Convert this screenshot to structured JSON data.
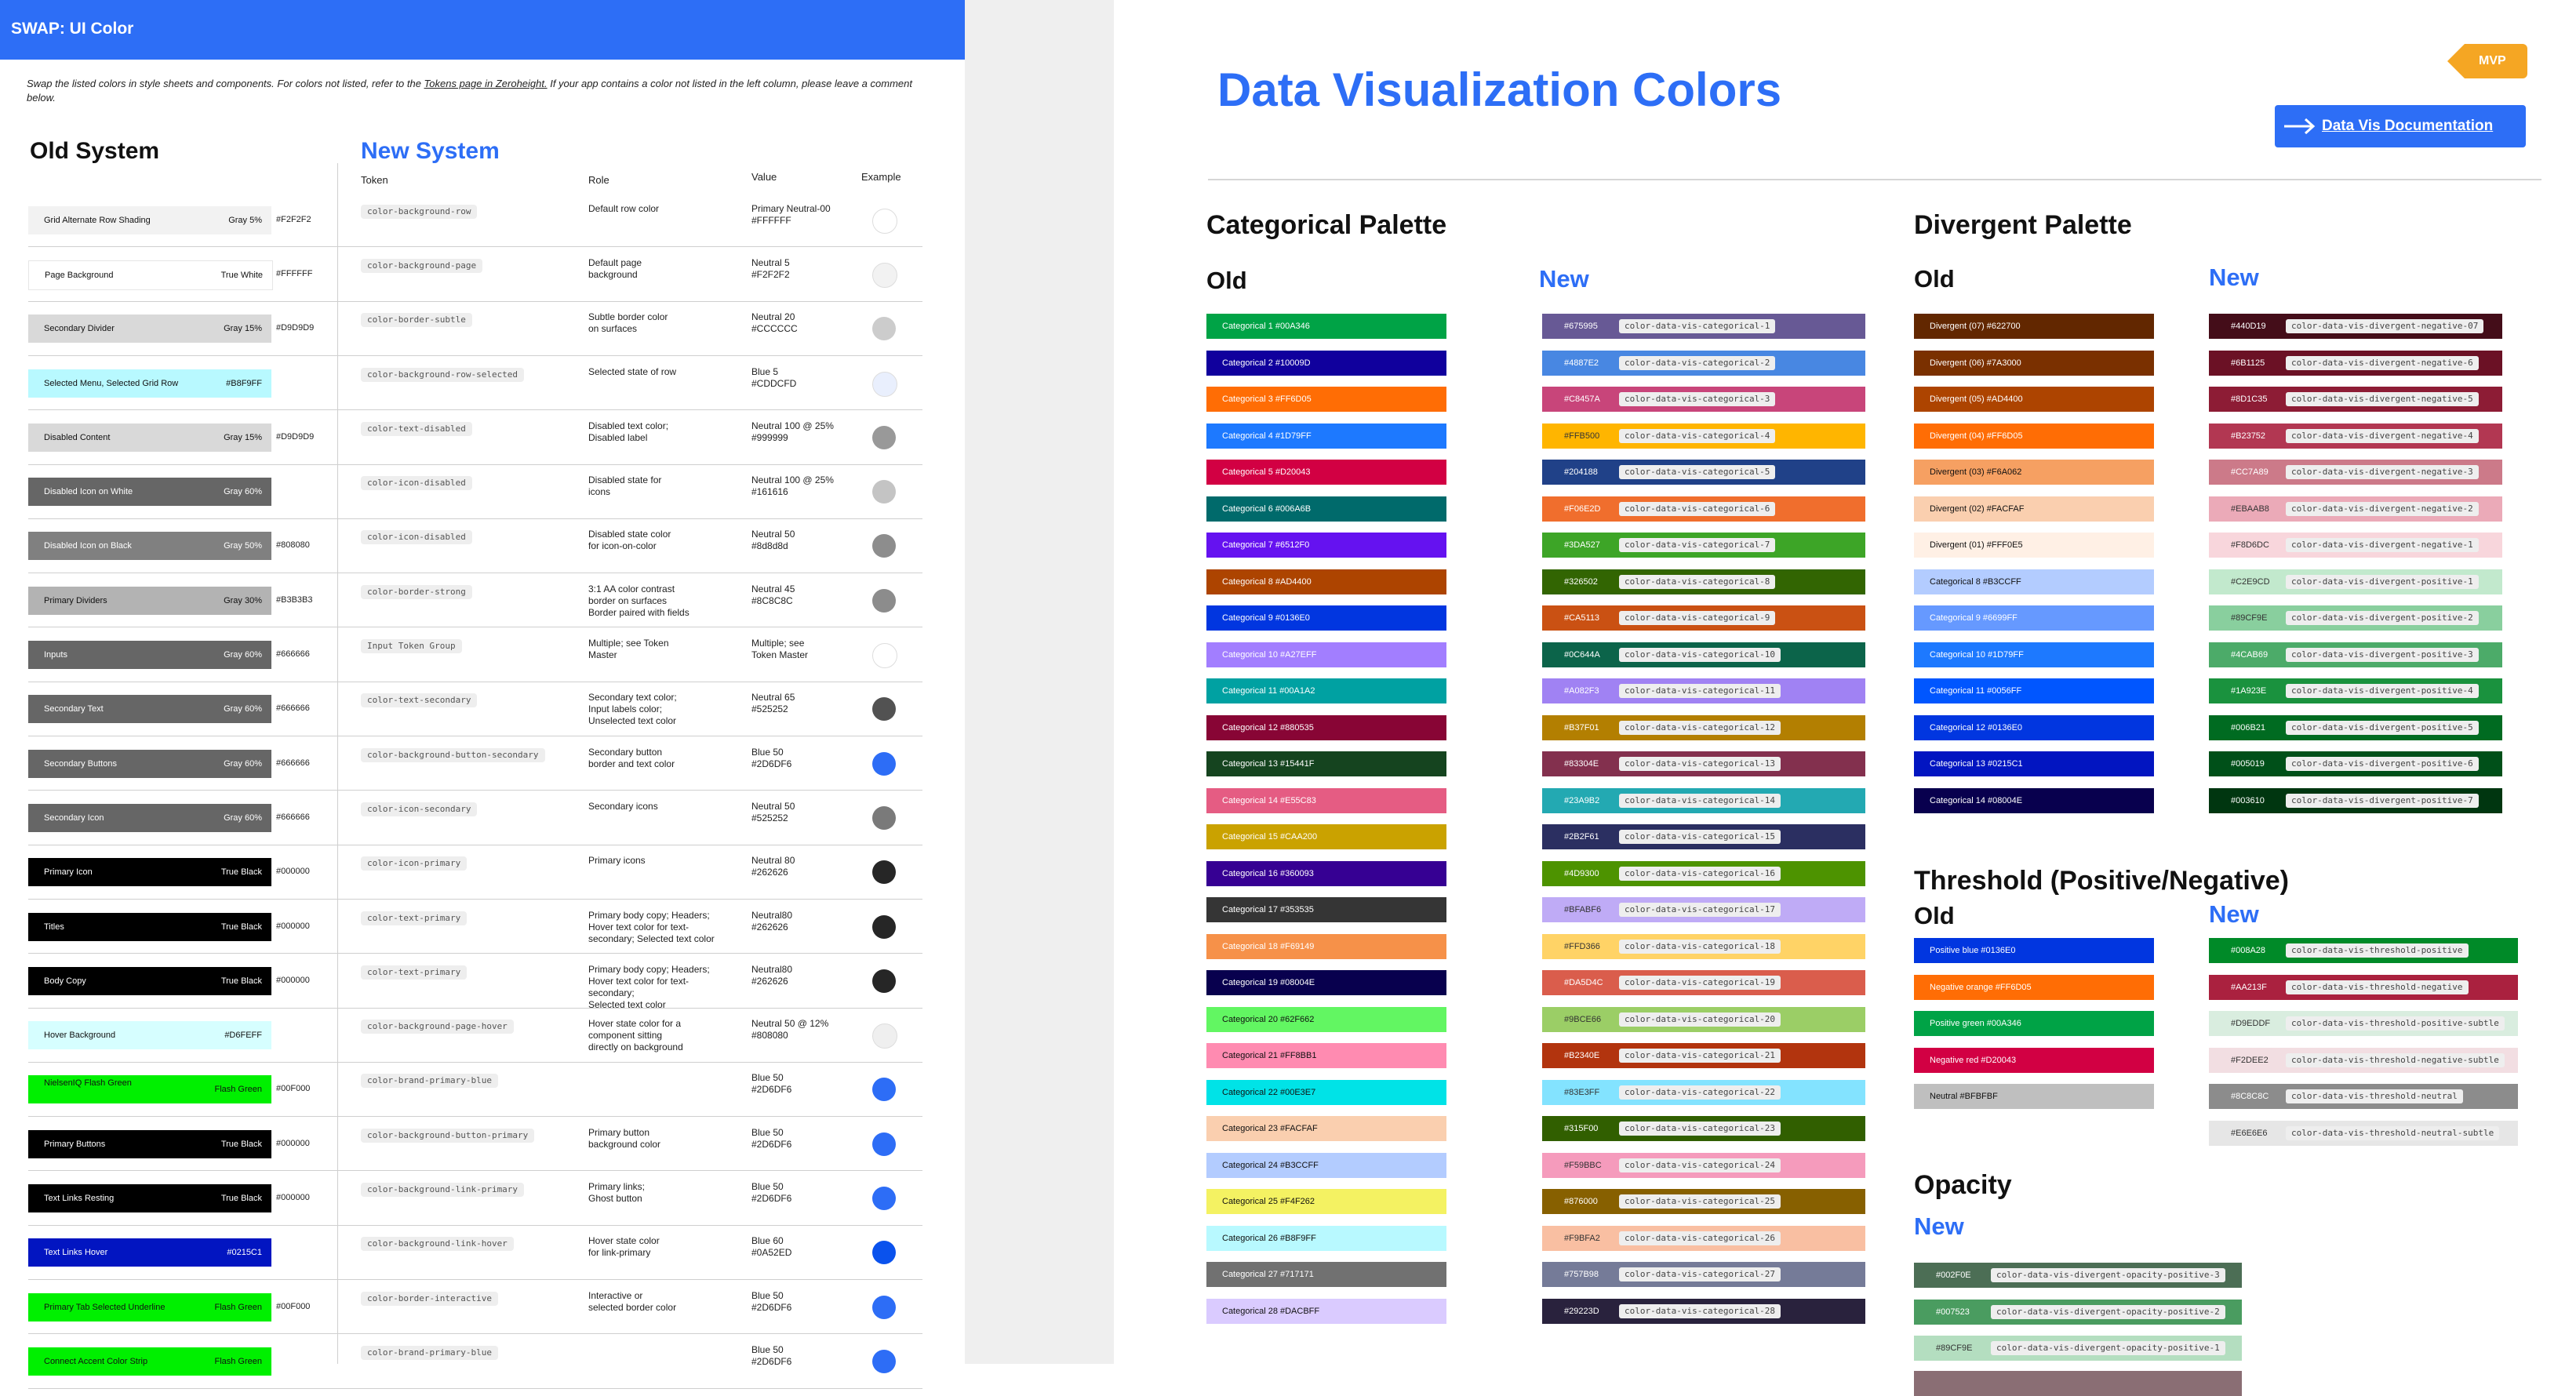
{
  "left": {
    "header": "SWAP: UI Color",
    "intro_a": "Swap the listed colors in style sheets and components. For colors not listed, refer to the ",
    "intro_link": "Tokens page in Zeroheight.",
    "intro_b": " If your app contains a color not listed in the left column, please leave a comment below.",
    "old_heading": "Old System",
    "new_heading": "New System",
    "col_token": "Token",
    "col_role": "Role",
    "col_value": "Value",
    "col_example": "Example",
    "rows": [
      {
        "name": "Grid Alternate Row Shading",
        "gray": "Gray 5%",
        "hex": "#F2F2F2",
        "bg": "#F2F2F2",
        "fg": "#111111",
        "token": "color-background-row",
        "role": [
          "Default row color"
        ],
        "value": [
          "Primary Neutral-00",
          "#FFFFFF"
        ],
        "example": "#FFFFFF"
      },
      {
        "name": "Page Background",
        "gray": "True White",
        "hex": "#FFFFFF",
        "bg": "#FFFFFF",
        "fg": "#111111",
        "token": "color-background-page",
        "role": [
          "Default page",
          "background"
        ],
        "value": [
          "Neutral 5",
          "#F2F2F2"
        ],
        "example": "#F2F2F2"
      },
      {
        "name": "Secondary Divider",
        "gray": "Gray 15%",
        "hex": "#D9D9D9",
        "bg": "#D9D9D9",
        "fg": "#111111",
        "token": "color-border-subtle",
        "role": [
          "Subtle border color",
          "on surfaces"
        ],
        "value": [
          "Neutral 20",
          "#CCCCCC"
        ],
        "example": "#CCCCCC"
      },
      {
        "name": "Selected Menu, Selected Grid Row",
        "gray": "#B8F9FF",
        "hex": "",
        "bg": "#B8F9FF",
        "fg": "#111111",
        "token": "color-background-row-selected",
        "role": [
          "Selected state of row"
        ],
        "value": [
          "Blue 5",
          "#CDDCFD"
        ],
        "example": "#E9EFFD"
      },
      {
        "name": "Disabled Content",
        "gray": "Gray 15%",
        "hex": "#D9D9D9",
        "bg": "#D9D9D9",
        "fg": "#111111",
        "token": "color-text-disabled",
        "role": [
          "Disabled text color;",
          "Disabled label"
        ],
        "value": [
          "Neutral 100 @ 25%",
          "#999999"
        ],
        "example": "#999999"
      },
      {
        "name": "Disabled Icon on White",
        "gray": "Gray 60%",
        "hex": "",
        "bg": "#666666",
        "fg": "#FFFFFF",
        "token": "color-icon-disabled",
        "role": [
          "Disabled state for",
          "icons"
        ],
        "value": [
          "Neutral 100 @ 25%",
          "#161616"
        ],
        "example": "#C4C4C4"
      },
      {
        "name": "Disabled Icon on Black",
        "gray": "Gray 50%",
        "hex": "#808080",
        "bg": "#808080",
        "fg": "#FFFFFF",
        "token": "color-icon-disabled",
        "role": [
          "Disabled state color",
          "for icon-on-color"
        ],
        "value": [
          "Neutral 50",
          "#8d8d8d"
        ],
        "example": "#8D8D8D"
      },
      {
        "name": "Primary Dividers",
        "gray": "Gray 30%",
        "hex": "#B3B3B3",
        "bg": "#B3B3B3",
        "fg": "#111111",
        "token": "color-border-strong",
        "role": [
          "3:1 AA color contrast",
          "border on surfaces",
          "Border paired with fields"
        ],
        "value": [
          "Neutral 45",
          "#8C8C8C"
        ],
        "example": "#8C8C8C"
      },
      {
        "name": "Inputs",
        "gray": "Gray 60%",
        "hex": "#666666",
        "bg": "#666666",
        "fg": "#FFFFFF",
        "token": "Input Token Group",
        "role": [
          "Multiple; see Token",
          "Master"
        ],
        "value": [
          "Multiple; see",
          "Token Master"
        ],
        "example": "#FFFFFF"
      },
      {
        "name": "Secondary Text",
        "gray": "Gray 60%",
        "hex": "#666666",
        "bg": "#666666",
        "fg": "#FFFFFF",
        "token": "color-text-secondary",
        "role": [
          "Secondary text color;",
          "Input labels color;",
          "Unselected text color"
        ],
        "value": [
          "Neutral 65",
          "#525252"
        ],
        "example": "#525252"
      },
      {
        "name": "Secondary Buttons",
        "gray": "Gray 60%",
        "hex": "#666666",
        "bg": "#666666",
        "fg": "#FFFFFF",
        "token": "color-background-button-secondary",
        "role": [
          "Secondary button",
          "border and text color"
        ],
        "value": [
          "Blue 50",
          "#2D6DF6"
        ],
        "example": "#2D6DF6"
      },
      {
        "name": "Secondary Icon",
        "gray": "Gray 60%",
        "hex": "#666666",
        "bg": "#666666",
        "fg": "#FFFFFF",
        "token": "color-icon-secondary",
        "role": [
          "Secondary icons"
        ],
        "value": [
          "Neutral 50",
          "#525252"
        ],
        "example": "#7A7A7A"
      },
      {
        "name": "Primary Icon",
        "gray": "True Black",
        "hex": "#000000",
        "bg": "#000000",
        "fg": "#FFFFFF",
        "token": "color-icon-primary",
        "role": [
          "Primary icons"
        ],
        "value": [
          "Neutral 80",
          "#262626"
        ],
        "example": "#262626"
      },
      {
        "name": "Titles",
        "gray": "True Black",
        "hex": "#000000",
        "bg": "#000000",
        "fg": "#FFFFFF",
        "token": "color-text-primary",
        "role": [
          "Primary body copy; Headers;",
          "Hover text color for text-",
          "secondary; Selected text color"
        ],
        "value": [
          "Neutral80",
          "#262626"
        ],
        "example": "#262626"
      },
      {
        "name": "Body Copy",
        "gray": "True Black",
        "hex": "#000000",
        "bg": "#000000",
        "fg": "#FFFFFF",
        "token": "color-text-primary",
        "role": [
          "Primary body copy; Headers;",
          "Hover text color for text-",
          "secondary;",
          "Selected text color"
        ],
        "value": [
          "Neutral80",
          "#262626"
        ],
        "example": "#262626"
      },
      {
        "name": "Hover Background",
        "gray": "#D6FEFF",
        "hex": "",
        "bg": "#D6FEFF",
        "fg": "#111111",
        "token": "color-background-page-hover",
        "role": [
          "Hover state color for a",
          "component sitting",
          "directly on  background"
        ],
        "value": [
          "Neutral 50 @ 12%",
          "#808080"
        ],
        "example": "#EFEFEF"
      },
      {
        "name": "NielsenIQ Flash Green",
        "gray": "Flash Green",
        "hex": "#00F000",
        "bg": "#00F000",
        "fg": "#111111",
        "token": "color-brand-primary-blue",
        "role": [],
        "value": [
          "Blue 50",
          "#2D6DF6"
        ],
        "example": "#2D6DF6"
      },
      {
        "name": "Primary Buttons",
        "gray": "True Black",
        "hex": "#000000",
        "bg": "#000000",
        "fg": "#FFFFFF",
        "token": "color-background-button-primary",
        "role": [
          "Primary button",
          "background color"
        ],
        "value": [
          "Blue 50",
          "#2D6DF6"
        ],
        "example": "#2D6DF6"
      },
      {
        "name": "Text Links Resting",
        "gray": "True Black",
        "hex": "#000000",
        "bg": "#000000",
        "fg": "#FFFFFF",
        "token": "color-background-link-primary",
        "role": [
          "Primary links;",
          "Ghost button"
        ],
        "value": [
          "Blue 50",
          "#2D6DF6"
        ],
        "example": "#2D6DF6"
      },
      {
        "name": "Text Links Hover",
        "gray": "#0215C1",
        "hex": "",
        "bg": "#0215C1",
        "fg": "#FFFFFF",
        "token": "color-background-link-hover",
        "role": [
          "Hover state color",
          "for link-primary"
        ],
        "value": [
          "Blue 60",
          "#0A52ED"
        ],
        "example": "#0A52ED"
      },
      {
        "name": "Primary Tab Selected Underline",
        "gray": "Flash Green",
        "hex": "#00F000",
        "bg": "#00F000",
        "fg": "#111111",
        "token": "color-border-interactive",
        "role": [
          "Interactive or",
          "selected border color"
        ],
        "value": [
          "Blue 50",
          "#2D6DF6"
        ],
        "example": "#2D6DF6"
      },
      {
        "name": "Connect Accent Color Strip",
        "gray": "Flash Green",
        "hex": "",
        "bg": "#00F000",
        "fg": "#111111",
        "token": "color-brand-primary-blue",
        "role": [],
        "value": [
          "Blue 50",
          "#2D6DF6"
        ],
        "example": "#2D6DF6"
      }
    ]
  },
  "right": {
    "title": "Data Visualization Colors",
    "mvp": "MVP",
    "doc_button": "Data Vis Documentation",
    "categorical_heading": "Categorical Palette",
    "divergent_heading": "Divergent Palette",
    "threshold_heading": "Threshold (Positive/Negative)",
    "opacity_heading": "Opacity",
    "old_label": "Old",
    "new_label": "New",
    "categorical_old": [
      {
        "label": "Categorical 1 #00A346",
        "bg": "#00A346",
        "fg": "#FFFFFF"
      },
      {
        "label": "Categorical 2 #10009D",
        "bg": "#10009D",
        "fg": "#FFFFFF"
      },
      {
        "label": "Categorical 3 #FF6D05",
        "bg": "#FF6D05",
        "fg": "#FFFFFF"
      },
      {
        "label": "Categorical 4 #1D79FF",
        "bg": "#1D79FF",
        "fg": "#FFFFFF"
      },
      {
        "label": "Categorical 5 #D20043",
        "bg": "#D20043",
        "fg": "#FFFFFF"
      },
      {
        "label": "Categorical 6 #006A6B",
        "bg": "#006A6B",
        "fg": "#FFFFFF"
      },
      {
        "label": "Categorical 7 #6512F0",
        "bg": "#6512F0",
        "fg": "#FFFFFF"
      },
      {
        "label": "Categorical 8 #AD4400",
        "bg": "#AD4400",
        "fg": "#FFFFFF"
      },
      {
        "label": "Categorical 9 #0136E0",
        "bg": "#0136E0",
        "fg": "#FFFFFF"
      },
      {
        "label": "Categorical 10 #A27EFF",
        "bg": "#A27EFF",
        "fg": "#FFFFFF"
      },
      {
        "label": "Categorical 11 #00A1A2",
        "bg": "#00A1A2",
        "fg": "#FFFFFF"
      },
      {
        "label": "Categorical 12 #880535",
        "bg": "#880535",
        "fg": "#FFFFFF"
      },
      {
        "label": "Categorical 13 #15441F",
        "bg": "#15441F",
        "fg": "#FFFFFF"
      },
      {
        "label": "Categorical 14 #E55C83",
        "bg": "#E55C83",
        "fg": "#FFFFFF"
      },
      {
        "label": "Categorical 15 #CAA200",
        "bg": "#CAA200",
        "fg": "#FFFFFF"
      },
      {
        "label": "Categorical 16 #360093",
        "bg": "#360093",
        "fg": "#FFFFFF"
      },
      {
        "label": "Categorical 17 #353535",
        "bg": "#353535",
        "fg": "#FFFFFF"
      },
      {
        "label": "Categorical 18 #F69149",
        "bg": "#F69149",
        "fg": "#FFFFFF"
      },
      {
        "label": "Categorical 19 #08004E",
        "bg": "#08004E",
        "fg": "#FFFFFF"
      },
      {
        "label": "Categorical 20 #62F662",
        "bg": "#62F662",
        "fg": "#111111"
      },
      {
        "label": "Categorical 21 #FF8BB1",
        "bg": "#FF8BB1",
        "fg": "#111111"
      },
      {
        "label": "Categorical 22 #00E3E7",
        "bg": "#00E3E7",
        "fg": "#111111"
      },
      {
        "label": "Categorical 23 #FACFAF",
        "bg": "#FACFAF",
        "fg": "#111111"
      },
      {
        "label": "Categorical 24 #B3CCFF",
        "bg": "#B3CCFF",
        "fg": "#111111"
      },
      {
        "label": "Categorical 25 #F4F262",
        "bg": "#F4F262",
        "fg": "#111111"
      },
      {
        "label": "Categorical 26 #B8F9FF",
        "bg": "#B8F9FF",
        "fg": "#111111"
      },
      {
        "label": "Categorical 27 #717171",
        "bg": "#717171",
        "fg": "#FFFFFF"
      },
      {
        "label": "Categorical 28 #DACBFF",
        "bg": "#DACBFF",
        "fg": "#111111"
      }
    ],
    "categorical_new": [
      {
        "hex": "#675995",
        "token": "color-data-vis-categorical-1"
      },
      {
        "hex": "#4887E2",
        "token": "color-data-vis-categorical-2"
      },
      {
        "hex": "#C8457A",
        "token": "color-data-vis-categorical-3"
      },
      {
        "hex": "#FFB500",
        "token": "color-data-vis-categorical-4"
      },
      {
        "hex": "#204188",
        "token": "color-data-vis-categorical-5"
      },
      {
        "hex": "#F06E2D",
        "token": "color-data-vis-categorical-6"
      },
      {
        "hex": "#3DA527",
        "token": "color-data-vis-categorical-7"
      },
      {
        "hex": "#326502",
        "token": "color-data-vis-categorical-8"
      },
      {
        "hex": "#CA5113",
        "token": "color-data-vis-categorical-9"
      },
      {
        "hex": "#0C644A",
        "token": "color-data-vis-categorical-10"
      },
      {
        "hex": "#A082F3",
        "token": "color-data-vis-categorical-11"
      },
      {
        "hex": "#B37F01",
        "token": "color-data-vis-categorical-12"
      },
      {
        "hex": "#83304E",
        "token": "color-data-vis-categorical-13"
      },
      {
        "hex": "#23A9B2",
        "token": "color-data-vis-categorical-14"
      },
      {
        "hex": "#2B2F61",
        "token": "color-data-vis-categorical-15"
      },
      {
        "hex": "#4D9300",
        "token": "color-data-vis-categorical-16"
      },
      {
        "hex": "#BFABF6",
        "token": "color-data-vis-categorical-17"
      },
      {
        "hex": "#FFD366",
        "token": "color-data-vis-categorical-18"
      },
      {
        "hex": "#DA5D4C",
        "token": "color-data-vis-categorical-19"
      },
      {
        "hex": "#9BCE66",
        "token": "color-data-vis-categorical-20"
      },
      {
        "hex": "#B2340E",
        "token": "color-data-vis-categorical-21"
      },
      {
        "hex": "#83E3FF",
        "token": "color-data-vis-categorical-22"
      },
      {
        "hex": "#315F00",
        "token": "color-data-vis-categorical-23"
      },
      {
        "hex": "#F59BBC",
        "token": "color-data-vis-categorical-24"
      },
      {
        "hex": "#876000",
        "token": "color-data-vis-categorical-25"
      },
      {
        "hex": "#F9BFA2",
        "token": "color-data-vis-categorical-26"
      },
      {
        "hex": "#757B98",
        "token": "color-data-vis-categorical-27"
      },
      {
        "hex": "#29223D",
        "token": "color-data-vis-categorical-28"
      }
    ],
    "divergent_old": [
      {
        "label": "Divergent (07) #622700",
        "bg": "#622700",
        "fg": "#FFFFFF"
      },
      {
        "label": "Divergent (06) #7A3000",
        "bg": "#7A3000",
        "fg": "#FFFFFF"
      },
      {
        "label": "Divergent (05) #AD4400",
        "bg": "#AD4400",
        "fg": "#FFFFFF"
      },
      {
        "label": "Divergent (04) #FF6D05",
        "bg": "#FF6D05",
        "fg": "#FFFFFF"
      },
      {
        "label": "Divergent (03) #F6A062",
        "bg": "#F6A062",
        "fg": "#111111"
      },
      {
        "label": "Divergent (02) #FACFAF",
        "bg": "#FACFAF",
        "fg": "#111111"
      },
      {
        "label": "Divergent (01) #FFF0E5",
        "bg": "#FFF0E5",
        "fg": "#111111"
      },
      {
        "label": "Categorical 8 #B3CCFF",
        "bg": "#B3CCFF",
        "fg": "#111111"
      },
      {
        "label": "Categorical 9 #6699FF",
        "bg": "#6699FF",
        "fg": "#FFFFFF"
      },
      {
        "label": "Categorical 10 #1D79FF",
        "bg": "#1D79FF",
        "fg": "#FFFFFF"
      },
      {
        "label": "Categorical 11 #0056FF",
        "bg": "#0056FF",
        "fg": "#FFFFFF"
      },
      {
        "label": "Categorical 12 #0136E0",
        "bg": "#0136E0",
        "fg": "#FFFFFF"
      },
      {
        "label": "Categorical 13 #0215C1",
        "bg": "#0215C1",
        "fg": "#FFFFFF"
      },
      {
        "label": "Categorical 14 #08004E",
        "bg": "#08004E",
        "fg": "#FFFFFF"
      }
    ],
    "divergent_new": [
      {
        "hex": "#440D19",
        "token": "color-data-vis-divergent-negative-07"
      },
      {
        "hex": "#6B1125",
        "token": "color-data-vis-divergent-negative-6"
      },
      {
        "hex": "#8D1C35",
        "token": "color-data-vis-divergent-negative-5"
      },
      {
        "hex": "#B23752",
        "token": "color-data-vis-divergent-negative-4"
      },
      {
        "hex": "#CC7A89",
        "token": "color-data-vis-divergent-negative-3"
      },
      {
        "hex": "#EBAAB8",
        "token": "color-data-vis-divergent-negative-2"
      },
      {
        "hex": "#F8D6DC",
        "token": "color-data-vis-divergent-negative-1"
      },
      {
        "hex": "#C2E9CD",
        "token": "color-data-vis-divergent-positive-1"
      },
      {
        "hex": "#89CF9E",
        "token": "color-data-vis-divergent-positive-2"
      },
      {
        "hex": "#4CAB69",
        "token": "color-data-vis-divergent-positive-3"
      },
      {
        "hex": "#1A923E",
        "token": "color-data-vis-divergent-positive-4"
      },
      {
        "hex": "#006B21",
        "token": "color-data-vis-divergent-positive-5"
      },
      {
        "hex": "#005019",
        "token": "color-data-vis-divergent-positive-6"
      },
      {
        "hex": "#003610",
        "token": "color-data-vis-divergent-positive-7"
      }
    ],
    "threshold_old": [
      {
        "label": "Positive blue #0136E0",
        "bg": "#0136E0",
        "fg": "#FFFFFF"
      },
      {
        "label": "Negative orange #FF6D05",
        "bg": "#FF6D05",
        "fg": "#FFFFFF"
      },
      {
        "label": "Positive green #00A346",
        "bg": "#00A346",
        "fg": "#FFFFFF"
      },
      {
        "label": "Negative red #D20043",
        "bg": "#D20043",
        "fg": "#FFFFFF"
      },
      {
        "label": "Neutral #BFBFBF",
        "bg": "#BFBFBF",
        "fg": "#111111"
      }
    ],
    "threshold_new": [
      {
        "hex": "#008A28",
        "token": "color-data-vis-threshold-positive"
      },
      {
        "hex": "#AA213F",
        "token": "color-data-vis-threshold-negative"
      },
      {
        "hex": "#D9EDDF",
        "token": "color-data-vis-threshold-positive-subtle"
      },
      {
        "hex": "#F2DEE2",
        "token": "color-data-vis-threshold-negative-subtle"
      },
      {
        "hex": "#8C8C8C",
        "token": "color-data-vis-threshold-neutral"
      },
      {
        "hex": "#E6E6E6",
        "token": "color-data-vis-threshold-neutral-subtle"
      }
    ],
    "opacity_new": [
      {
        "hex": "#002F0E",
        "bg": "#4C6E55",
        "token": "color-data-vis-divergent-opacity-positive-3"
      },
      {
        "hex": "#007523",
        "bg": "#4A9C60",
        "token": "color-data-vis-divergent-opacity-positive-2"
      },
      {
        "hex": "#89CF9E",
        "bg": "#B4DEC0",
        "token": "color-data-vis-divergent-opacity-positive-1"
      }
    ]
  }
}
